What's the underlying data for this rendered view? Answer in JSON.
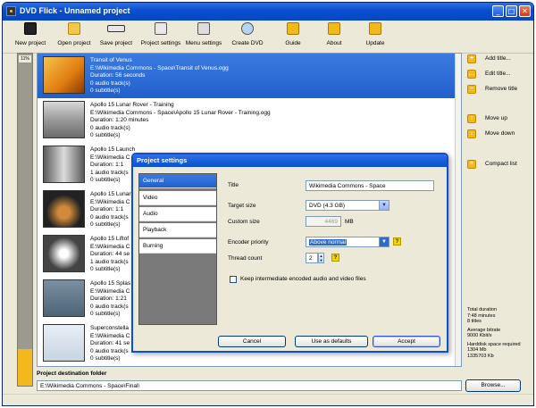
{
  "window": {
    "title": "DVD Flick - Unnamed project"
  },
  "toolbar": {
    "items": [
      {
        "label": "New project",
        "icon": "film-icon"
      },
      {
        "label": "Open project",
        "icon": "folder-icon"
      },
      {
        "label": "Save project",
        "icon": "save-icon"
      },
      {
        "label": "Project settings",
        "icon": "settings-icon"
      },
      {
        "label": "Menu settings",
        "icon": "menu-icon"
      },
      {
        "label": "Create DVD",
        "icon": "dvd-icon"
      },
      {
        "label": "Guide",
        "icon": "guide-icon"
      },
      {
        "label": "About",
        "icon": "about-icon"
      },
      {
        "label": "Update",
        "icon": "update-icon"
      }
    ]
  },
  "progress": {
    "label": "11%",
    "fraction": 0.11
  },
  "titles": [
    {
      "name": "Transit of Venus",
      "path": "E:\\Wikimedia Commons - Space\\Transit of Venus.ogg",
      "duration": "Duration: 56 seconds",
      "audio": "0 audio track(s)",
      "subtitles": "0 subtitle(s)",
      "selected": true
    },
    {
      "name": "Apollo 15 Lunar Rover - Training",
      "path": "E:\\Wikimedia Commons - Space\\Apollo 15 Lunar Rover - Training.ogg",
      "duration": "Duration: 1:20 minutes",
      "audio": "0 audio track(s)",
      "subtitles": "0 subtitle(s)",
      "selected": false
    },
    {
      "name": "Apollo 15 Launch",
      "path": "E:\\Wikimedia C",
      "duration": "Duration: 1:1",
      "audio": "1 audio track(s",
      "subtitles": "0 subtitle(s)",
      "selected": false
    },
    {
      "name": "Apollo 15 Lunar R",
      "path": "E:\\Wikimedia C",
      "duration": "Duration: 1:1",
      "audio": "0 audio track(s",
      "subtitles": "0 subtitle(s)",
      "selected": false
    },
    {
      "name": "Apollo 15 Liftof",
      "path": "E:\\Wikimedia C",
      "duration": "Duration: 44 se",
      "audio": "1 audio track(s",
      "subtitles": "0 subtitle(s)",
      "selected": false
    },
    {
      "name": "Apollo 15 Splas",
      "path": "E:\\Wikimedia C",
      "duration": "Duration: 1:21",
      "audio": "0 audio track(s",
      "subtitles": "0 subtitle(s)",
      "selected": false
    },
    {
      "name": "Superconstella",
      "path": "E:\\Wikimedia C",
      "duration": "Duration: 41 se",
      "audio": "0 audio track(s",
      "subtitles": "0 subtitle(s)",
      "selected": false
    }
  ],
  "right_panel": {
    "add_title": "Add title...",
    "edit_title": "Edit title...",
    "remove_title": "Remove title",
    "move_up": "Move up",
    "move_down": "Move down",
    "compact_list": "Compact list"
  },
  "stats": {
    "total_duration_label": "Total duration",
    "total_duration_value": "7:48 minutes",
    "titles_count": "8 titles",
    "avg_bitrate_label": "Average bitrate",
    "avg_bitrate_value": "9000 Kbit/s",
    "hd_space_label": "Harddisk space required",
    "hd_space_mb": "1304 Mb",
    "hd_space_kb": "1335703 Kb"
  },
  "destination": {
    "label": "Project destination folder",
    "path": "E:\\Wikimedia Commons - Space\\Final\\",
    "browse": "Browse..."
  },
  "dialog": {
    "title": "Project settings",
    "nav": [
      "General",
      "Video",
      "Audio",
      "Playback",
      "Burning"
    ],
    "active_nav": 0,
    "fields": {
      "title_label": "Title",
      "title_value": "Wikimedia Commons - Space",
      "target_size_label": "Target size",
      "target_size_value": "DVD (4.3 GB)",
      "custom_size_label": "Custom size",
      "custom_size_value": "4469",
      "custom_size_unit": "MB",
      "encoder_priority_label": "Encoder priority",
      "encoder_priority_value": "Above normal",
      "thread_count_label": "Thread count",
      "thread_count_value": "2",
      "keep_files_label": "Keep intermediate encoded audio and video files"
    },
    "buttons": {
      "cancel": "Cancel",
      "defaults": "Use as defaults",
      "accept": "Accept"
    }
  }
}
